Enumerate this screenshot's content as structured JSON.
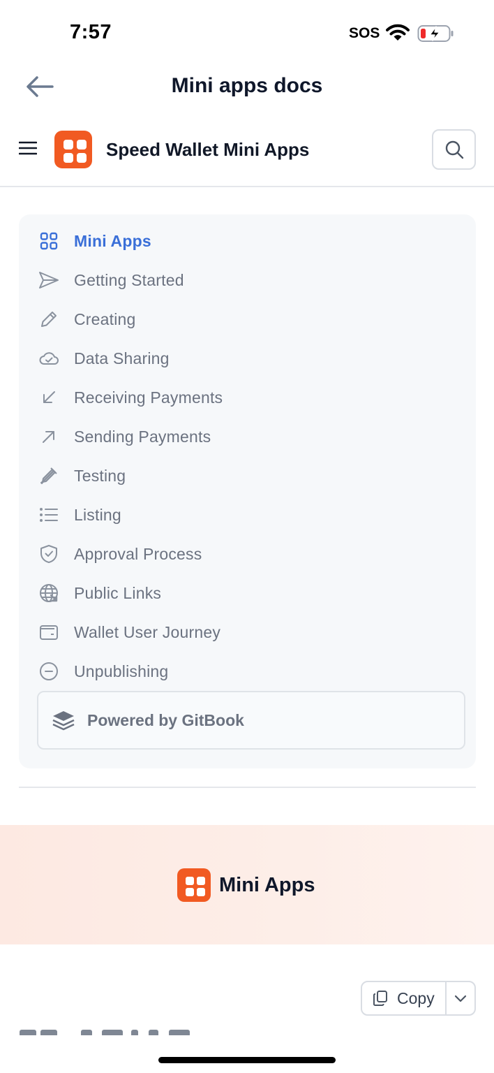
{
  "status_bar": {
    "time": "7:57",
    "sos": "SOS"
  },
  "nav": {
    "title": "Mini apps docs"
  },
  "header": {
    "site_title": "Speed Wallet Mini Apps"
  },
  "sidebar": {
    "items": [
      {
        "label": "Mini Apps",
        "icon": "grid-icon",
        "active": true
      },
      {
        "label": "Getting Started",
        "icon": "send-icon",
        "active": false
      },
      {
        "label": "Creating",
        "icon": "pencil-icon",
        "active": false
      },
      {
        "label": "Data Sharing",
        "icon": "cloud-check-icon",
        "active": false
      },
      {
        "label": "Receiving Payments",
        "icon": "arrow-down-left-icon",
        "active": false
      },
      {
        "label": "Sending Payments",
        "icon": "arrow-up-right-icon",
        "active": false
      },
      {
        "label": "Testing",
        "icon": "eyedropper-icon",
        "active": false
      },
      {
        "label": "Listing",
        "icon": "list-icon",
        "active": false
      },
      {
        "label": "Approval Process",
        "icon": "shield-check-icon",
        "active": false
      },
      {
        "label": "Public Links",
        "icon": "globe-icon",
        "active": false
      },
      {
        "label": "Wallet User Journey",
        "icon": "wallet-icon",
        "active": false
      },
      {
        "label": "Unpublishing",
        "icon": "minus-circle-icon",
        "active": false
      }
    ],
    "powered_by": "Powered by GitBook"
  },
  "hero": {
    "title": "Mini Apps"
  },
  "toolbar": {
    "copy_label": "Copy"
  },
  "colors": {
    "brand": "#f15a22",
    "active_link": "#3a6fd8",
    "sidebar_bg": "#f6f8fa"
  }
}
